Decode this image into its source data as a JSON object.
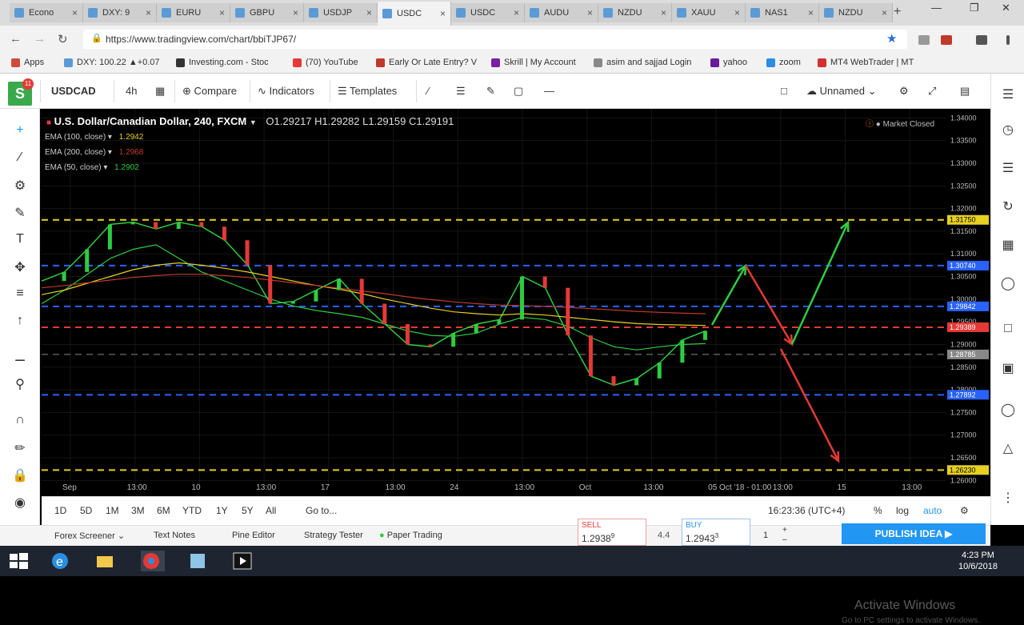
{
  "browser": {
    "tabs": [
      "Econo",
      "DXY: 9",
      "EURU",
      "GBPU",
      "USDJP",
      "USDC",
      "USDC",
      "AUDU",
      "NZDU",
      "XAUU",
      "NAS1",
      "NZDU"
    ],
    "active_tab": 5,
    "url": "https://www.tradingview.com/chart/bbiTJP67/",
    "bookmarks": [
      "Apps",
      "DXY: 100.22 ▲+0.07",
      "Investing.com - Stoc",
      "(70) YouTube",
      "Early Or Late Entry? V",
      "Skrill | My Account",
      "asim and sajjad Login",
      "yahoo",
      "zoom",
      "MT4 WebTrader | MT"
    ],
    "new_tab": "+"
  },
  "toolbar": {
    "symbol": "USDCAD",
    "interval": "4h",
    "compare": "Compare",
    "indicators": "Indicators",
    "templates": "Templates",
    "layout_name": "Unnamed",
    "logo_letter": "S",
    "logo_badge": "11"
  },
  "legend": {
    "title": "U.S. Dollar/Canadian Dollar, 240, FXCM",
    "ohlc": "O1.29217  H1.29282  L1.29159  C1.29191",
    "emas": [
      {
        "label": "EMA (100, close)",
        "value": "1.2942",
        "color": "#e6d020"
      },
      {
        "label": "EMA (200, close)",
        "value": "1.2968",
        "color": "#c0392b"
      },
      {
        "label": "EMA (50, close)",
        "value": "1.2902",
        "color": "#2ecc40"
      }
    ],
    "market_status": "Market Closed"
  },
  "chart_data": {
    "type": "line",
    "title": "U.S. Dollar/Canadian Dollar, 240, FXCM",
    "xlabel": "",
    "ylabel": "",
    "x": [
      "Sep",
      "13:00",
      "10",
      "13:00",
      "17",
      "13:00",
      "24",
      "13:00",
      "Oct",
      "13:00",
      "05 Oct '18 - 01:00",
      "13:00",
      "15",
      "13:00"
    ],
    "y_ticks": [
      "1.34000",
      "1.33500",
      "1.33000",
      "1.32500",
      "1.32000",
      "1.31500",
      "1.31000",
      "1.30500",
      "1.30000",
      "1.29500",
      "1.29000",
      "1.28500",
      "1.28000",
      "1.27500",
      "1.27000",
      "1.26500",
      "1.26000"
    ],
    "ylim": [
      1.259,
      1.342
    ],
    "series": [
      {
        "name": "USDCAD",
        "color": "#2ecc40",
        "values": [
          1.304,
          1.306,
          1.311,
          1.3165,
          1.317,
          1.3155,
          1.317,
          1.316,
          1.313,
          1.3075,
          1.299,
          1.2995,
          1.302,
          1.3045,
          1.299,
          1.2945,
          1.29,
          1.2895,
          1.2925,
          1.2945,
          1.2955,
          1.305,
          1.3025,
          1.292,
          1.283,
          1.281,
          1.2825,
          1.286,
          1.291,
          1.293
        ]
      },
      {
        "name": "EMA (50, close)",
        "color": "#2ecc40",
        "values": [
          1.299,
          1.302,
          1.3055,
          1.309,
          1.311,
          1.312,
          1.309,
          1.306,
          1.304,
          1.302,
          1.3,
          1.2985,
          1.2975,
          1.2968,
          1.296,
          1.2945,
          1.293,
          1.292,
          1.2918,
          1.2925,
          1.2945,
          1.296,
          1.2955,
          1.294,
          1.2915,
          1.2895,
          1.2888,
          1.2895,
          1.29,
          1.2902
        ]
      },
      {
        "name": "EMA (100, close)",
        "color": "#e6d020",
        "values": [
          1.301,
          1.302,
          1.3035,
          1.305,
          1.3065,
          1.3075,
          1.308,
          1.3075,
          1.3068,
          1.306,
          1.305,
          1.304,
          1.303,
          1.3022,
          1.3012,
          1.3,
          1.299,
          1.298,
          1.2972,
          1.2968,
          1.2965,
          1.2968,
          1.2965,
          1.296,
          1.2955,
          1.295,
          1.2946,
          1.2944,
          1.2943,
          1.2942
        ]
      },
      {
        "name": "EMA (200, close)",
        "color": "#c0392b",
        "values": [
          1.3025,
          1.303,
          1.3036,
          1.3042,
          1.3048,
          1.3052,
          1.3055,
          1.3055,
          1.3052,
          1.3048,
          1.3042,
          1.3036,
          1.303,
          1.3024,
          1.3018,
          1.3012,
          1.3005,
          1.2999,
          1.2994,
          1.299,
          1.2987,
          1.2986,
          1.2984,
          1.2982,
          1.2979,
          1.2976,
          1.2973,
          1.2971,
          1.2969,
          1.2968
        ]
      }
    ],
    "levels": [
      {
        "value": 1.3175,
        "label": "1.31750",
        "color": "#e6d020"
      },
      {
        "value": 1.3074,
        "label": "1.30740",
        "color": "#2962ff"
      },
      {
        "value": 1.2984,
        "label": "1.29842",
        "color": "#2962ff"
      },
      {
        "value": 1.2938,
        "label": "1.29389",
        "color": "#e53935"
      },
      {
        "value": 1.2878,
        "label": "1.28785",
        "color": "#888888"
      },
      {
        "value": 1.2789,
        "label": "1.27892",
        "color": "#2962ff"
      },
      {
        "value": 1.2623,
        "label": "1.26230",
        "color": "#e6d020"
      }
    ],
    "grid": true
  },
  "bottom": {
    "ranges": [
      "1D",
      "5D",
      "1M",
      "3M",
      "6M",
      "YTD",
      "1Y",
      "5Y",
      "All"
    ],
    "goto": "Go to...",
    "time": "16:23:36 (UTC+4)",
    "pct": "%",
    "log": "log",
    "auto": "auto",
    "footer": [
      "Forex Screener",
      "Text Notes",
      "Pine Editor",
      "Strategy Tester",
      "Paper Trading"
    ],
    "sell_label": "SELL",
    "sell_price": "1.2938",
    "sell_sup": "9",
    "spread": "4.4",
    "buy_label": "BUY",
    "buy_price": "1.2943",
    "buy_sup": "3",
    "qty": "1",
    "publish": "PUBLISH IDEA",
    "watermark": "Activate Windows",
    "watermark2": "Go to PC settings to activate Windows."
  },
  "taskbar": {
    "clock_time": "4:23 PM",
    "clock_date": "10/6/2018"
  }
}
